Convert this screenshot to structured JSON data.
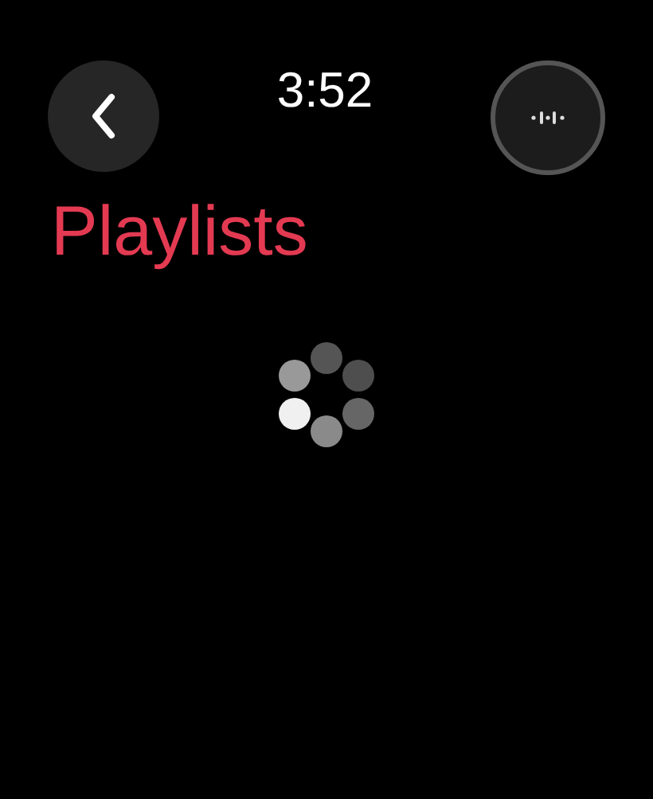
{
  "status_bar": {
    "time": "3:52"
  },
  "header": {
    "title": "Playlists"
  }
}
